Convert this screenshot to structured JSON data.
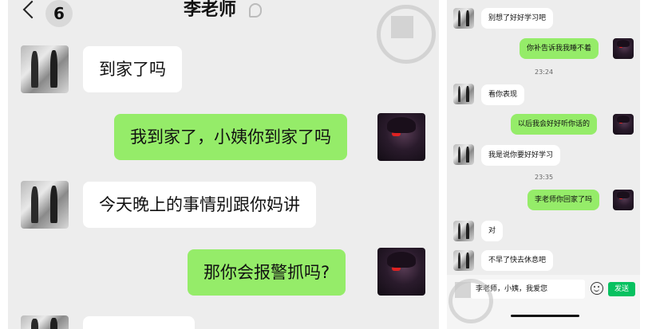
{
  "left": {
    "unread_count": "6",
    "contact_name": "李老师",
    "messages": [
      {
        "side": "in",
        "text": "到家了吗"
      },
      {
        "side": "out",
        "text": "我到家了，小姨你到家了吗"
      },
      {
        "side": "in",
        "text": "今天晚上的事情别跟你妈讲"
      },
      {
        "side": "out",
        "text": "那你会报警抓吗?"
      }
    ]
  },
  "right": {
    "messages": [
      {
        "side": "in",
        "text": "别想了好好学习吧"
      },
      {
        "side": "out",
        "text": "你补告诉我我睡不着"
      },
      {
        "side": "in",
        "text": "看你表现"
      },
      {
        "side": "out",
        "text": "以后我会好好听你话的"
      },
      {
        "side": "in",
        "text": "我是说你要好好学习"
      },
      {
        "side": "out",
        "text": "李老师你回家了吗"
      },
      {
        "side": "in",
        "text": "对"
      },
      {
        "side": "in",
        "text": "不早了快去休息吧"
      }
    ],
    "times": [
      "23:24",
      "23:35"
    ],
    "input_value": "李老师，小姨，我爱您",
    "send_label": "发送"
  },
  "icons": {
    "back": "chevron-left-icon",
    "voice": "ear-icon",
    "emoji": "smiley-icon"
  },
  "colors": {
    "outgoing_bubble": "#95ec69",
    "incoming_bubble": "#ffffff",
    "chat_background": "#ededed",
    "send_button": "#07c160"
  }
}
